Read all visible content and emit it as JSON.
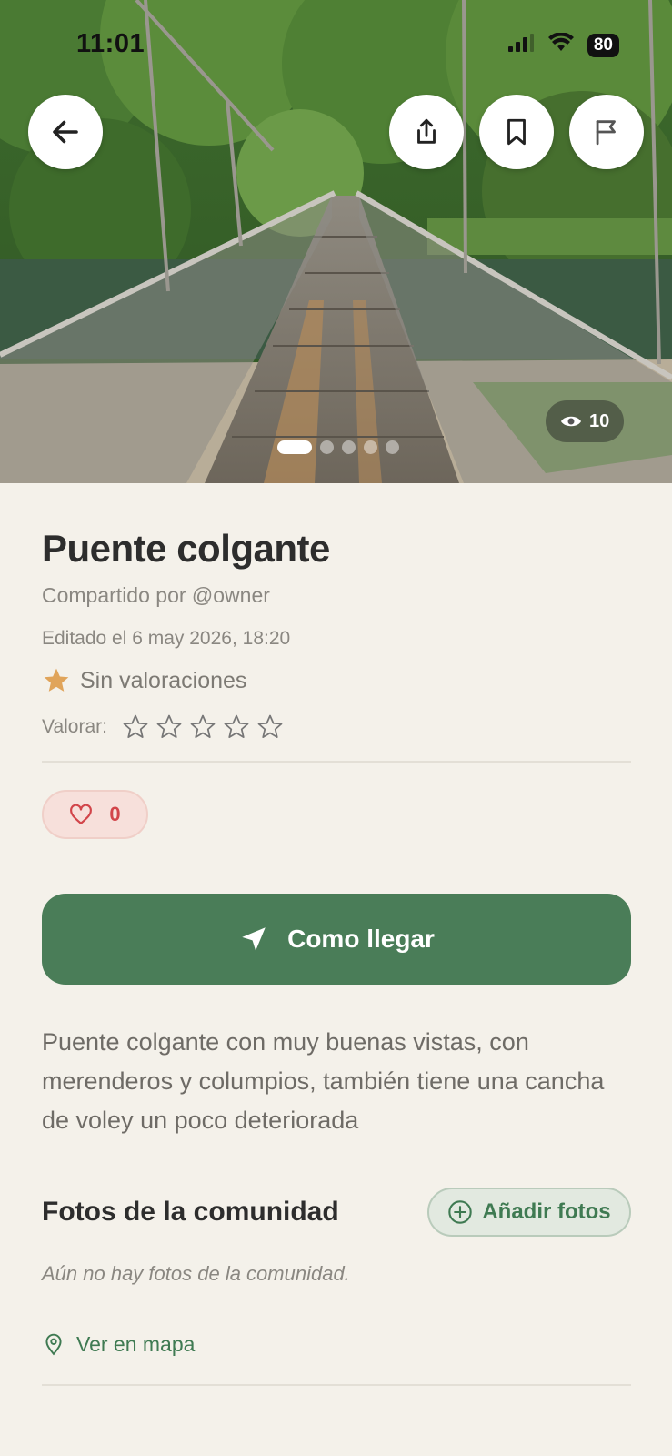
{
  "status_bar": {
    "time": "11:01",
    "battery": "80"
  },
  "hero": {
    "views_count": "10",
    "photo_count": 5,
    "active_photo": 1
  },
  "place": {
    "title": "Puente colgante",
    "shared_by": "Compartido por @owner",
    "edited": "Editado el 6 may 2026, 18:20",
    "rating_text": "Sin valoraciones",
    "rate_label": "Valorar:",
    "likes": "0",
    "directions_label": "Como llegar",
    "description": "Puente colgante con muy buenas vistas, con merenderos y columpios, también tiene una cancha de voley un poco deteriorada"
  },
  "community": {
    "title": "Fotos de la comunidad",
    "add_label": "Añadir fotos",
    "empty_text": "Aún no hay fotos de la comunidad."
  },
  "map_link": "Ver en mapa",
  "colors": {
    "accent": "#4a7d58",
    "background": "#f4f1ea",
    "star": "#e0a45a",
    "like": "#d2454a"
  },
  "icons": [
    "back-arrow-icon",
    "share-icon",
    "bookmark-icon",
    "flag-icon",
    "eye-icon",
    "star-icon",
    "heart-icon",
    "navigation-arrow-icon",
    "plus-circle-icon",
    "map-pin-icon"
  ]
}
